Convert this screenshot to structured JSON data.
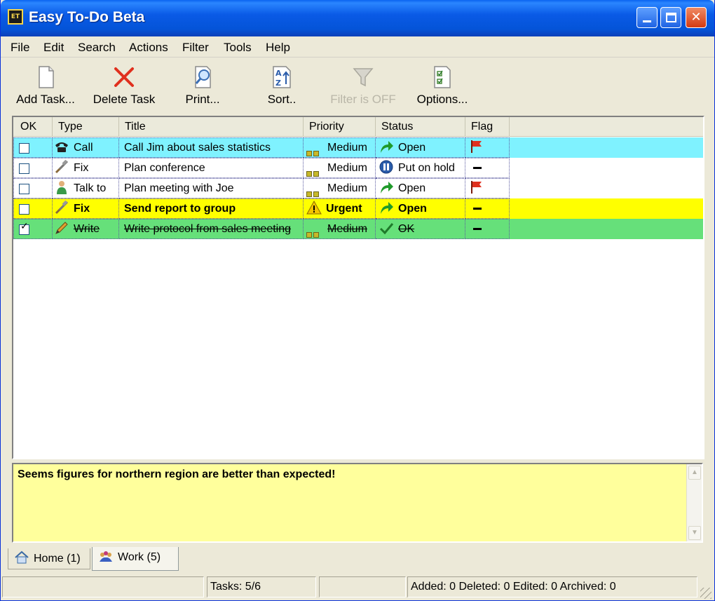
{
  "window": {
    "title": "Easy To-Do Beta",
    "icon_label": "ET"
  },
  "menu": [
    "File",
    "Edit",
    "Search",
    "Actions",
    "Filter",
    "Tools",
    "Help"
  ],
  "toolbar": {
    "add_task": "Add Task...",
    "delete_task": "Delete Task",
    "print": "Print...",
    "sort": "Sort..",
    "filter": "Filter is OFF",
    "options": "Options..."
  },
  "columns": {
    "ok": "OK",
    "type": "Type",
    "title": "Title",
    "priority": "Priority",
    "status": "Status",
    "flag": "Flag"
  },
  "tasks": [
    {
      "checked": false,
      "type": "Call",
      "type_icon": "phone-icon",
      "title": "Call Jim about sales statistics",
      "priority": "Medium",
      "status": "Open",
      "status_icon": "open-arrow-icon",
      "flag": "red-flag",
      "row_color": "#7ff2ff"
    },
    {
      "checked": false,
      "type": "Fix",
      "type_icon": "tools-icon",
      "title": "Plan conference",
      "priority": "Medium",
      "status": "Put on hold",
      "status_icon": "pause-icon",
      "flag": "none",
      "row_color": "#ffffff"
    },
    {
      "checked": false,
      "type": "Talk to",
      "type_icon": "person-icon",
      "title": "Plan meeting with Joe",
      "priority": "Medium",
      "status": "Open",
      "status_icon": "open-arrow-icon",
      "flag": "red-flag",
      "row_color": "#ffffff"
    },
    {
      "checked": false,
      "type": "Fix",
      "type_icon": "tools-icon",
      "title": "Send report to group",
      "priority": "Urgent",
      "status": "Open",
      "status_icon": "open-arrow-icon",
      "flag": "none",
      "row_color": "#ffff00"
    },
    {
      "checked": true,
      "type": "Write",
      "type_icon": "pencil-icon",
      "title": "Write protocol from sales meeting",
      "priority": "Medium",
      "status": "OK",
      "status_icon": "check-icon",
      "flag": "none",
      "row_color": "#66e07a"
    }
  ],
  "notes": {
    "text": "Seems figures for northern region are better than expected!",
    "background": "#ffff9c"
  },
  "tabs": [
    {
      "label": "Home (1)",
      "active": false
    },
    {
      "label": "Work (5)",
      "active": true
    }
  ],
  "status": {
    "tasks": "Tasks: 5/6",
    "summary": "Added: 0 Deleted: 0 Edited: 0 Archived: 0"
  }
}
